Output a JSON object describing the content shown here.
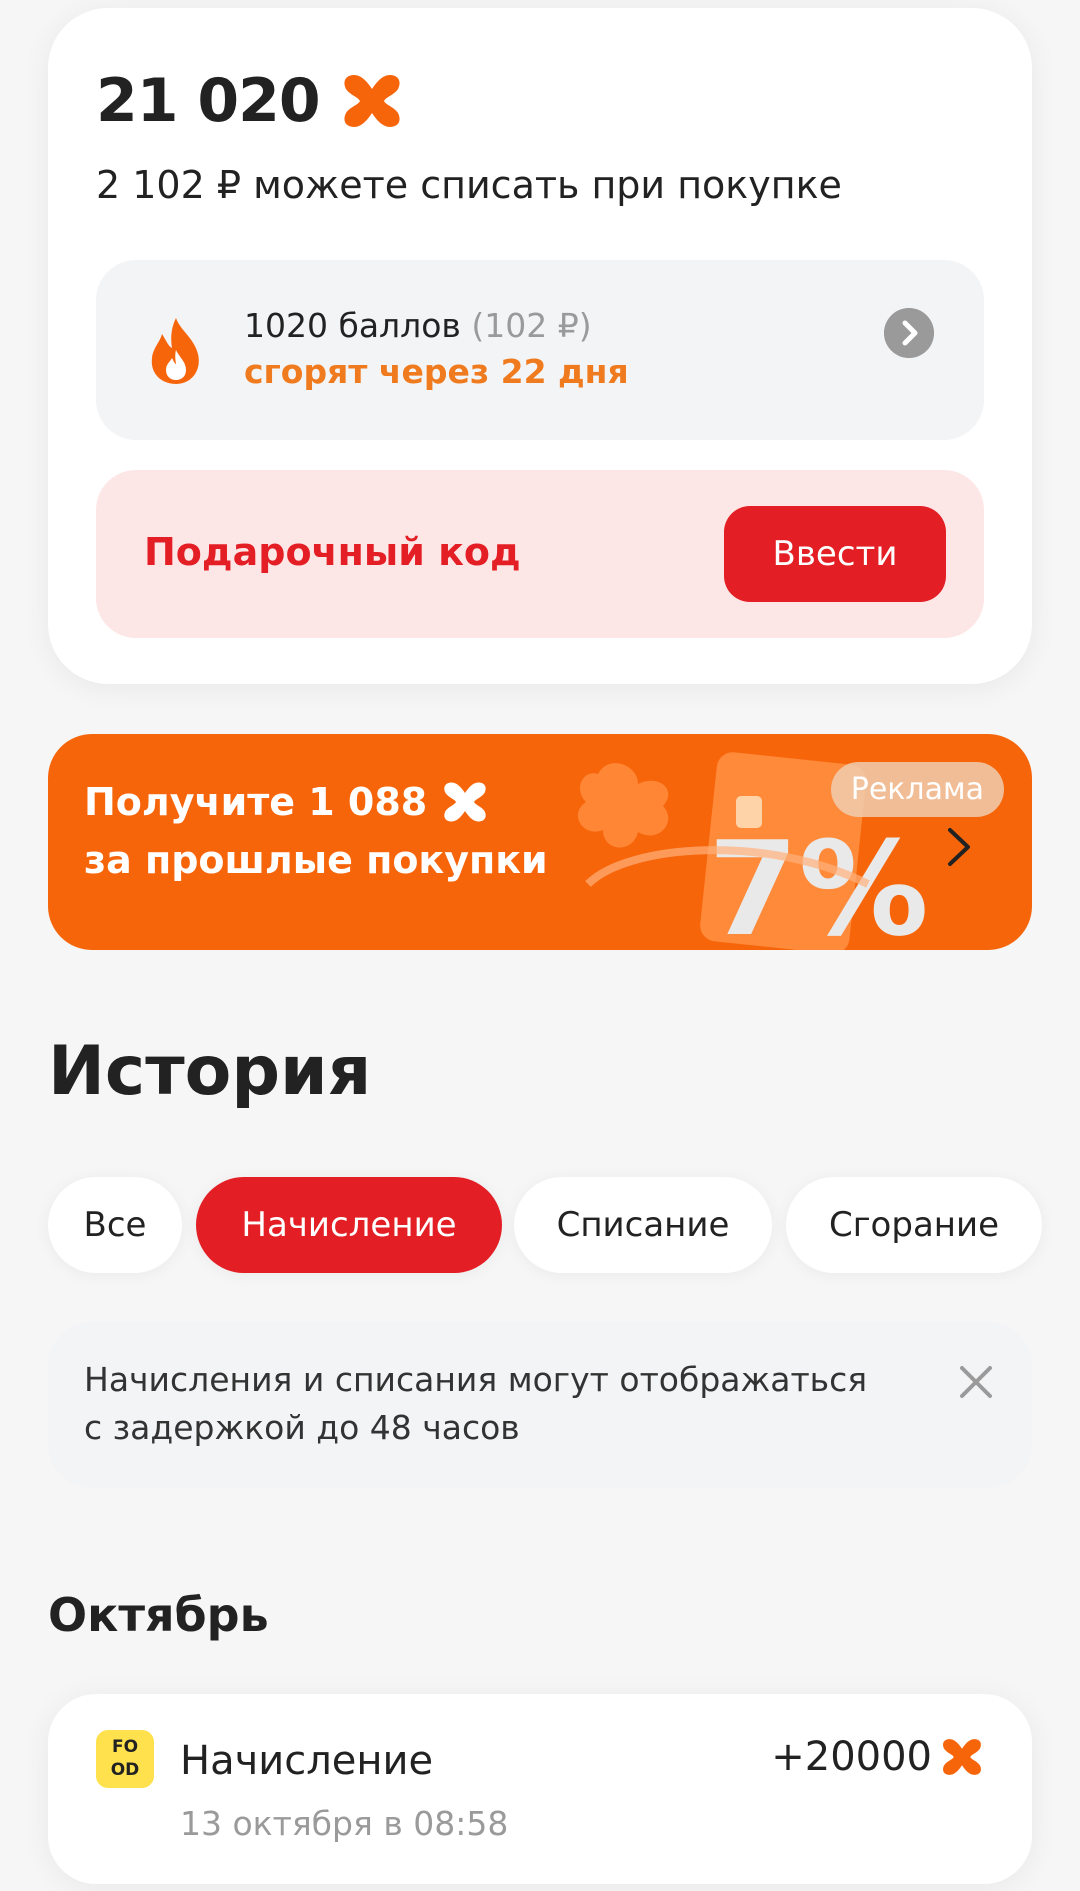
{
  "balance": {
    "value": "21 020",
    "subtitle": "2 102 ₽ можете списать при покупке",
    "icon": "orange-x-icon"
  },
  "burn": {
    "points": "1020 баллов",
    "rub": "(102 ₽)",
    "expires": "сгорят через 22 дня",
    "icon": "flame-icon"
  },
  "gift": {
    "label": "Подарочный код",
    "button": "Ввести"
  },
  "promo": {
    "line1": "Получите 1 088",
    "line2": "за прошлые покупки",
    "badge": "Реклама",
    "art_text": "7%"
  },
  "history": {
    "title": "История",
    "filters": [
      "Все",
      "Начисление",
      "Списание",
      "Сгорание"
    ],
    "active_filter": "Начисление",
    "notice": "Начисления и списания могут отображаться с задержкой до 48 часов",
    "month": "Октябрь",
    "transactions": [
      {
        "logo": [
          "FO",
          "OD"
        ],
        "title": "Начисление",
        "date": "13 октября в 08:58",
        "amount": "+20000"
      }
    ]
  },
  "colors": {
    "accent_red": "#e31e24",
    "accent_orange": "#f7650a",
    "point_orange": "#f07a1e"
  }
}
